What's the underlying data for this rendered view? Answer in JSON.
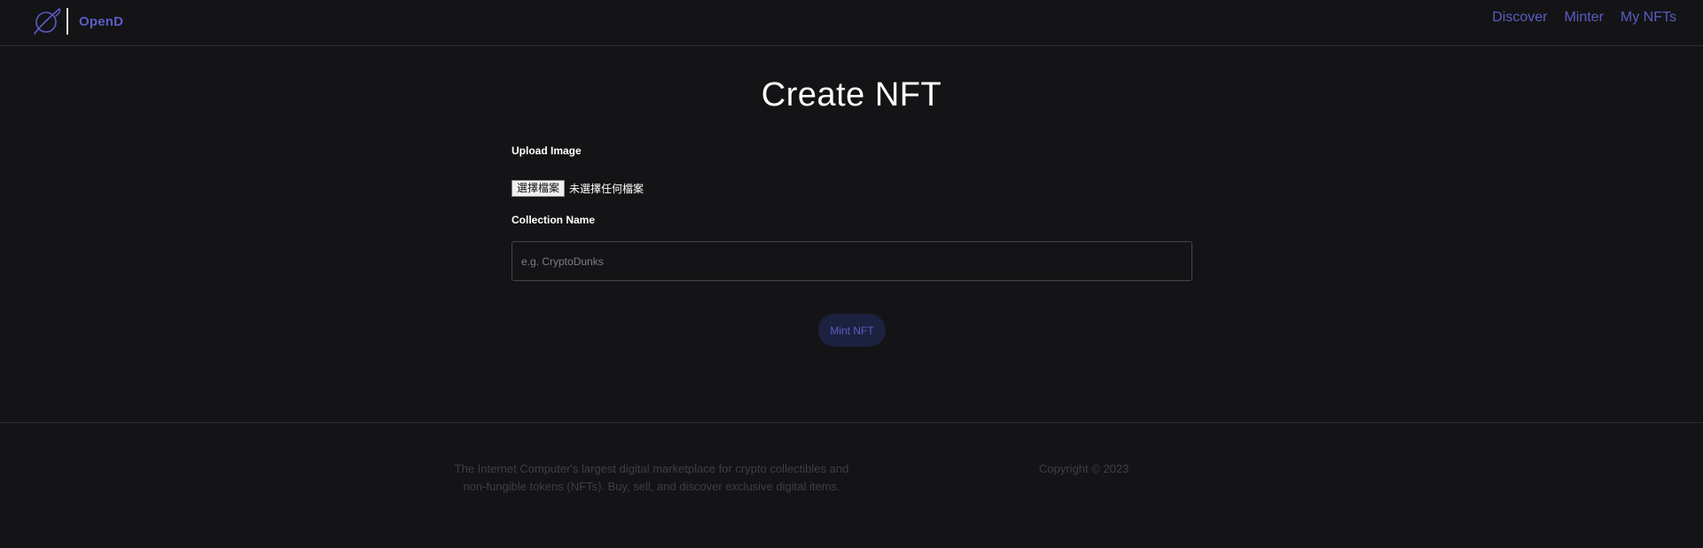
{
  "header": {
    "logo_icon": "planet-ring-icon",
    "brand": "OpenD",
    "nav": [
      {
        "label": "Discover"
      },
      {
        "label": "Minter"
      },
      {
        "label": "My NFTs"
      }
    ]
  },
  "main": {
    "title": "Create NFT",
    "upload_label": "Upload Image",
    "file_button_label": "選擇檔案",
    "file_status": "未選擇任何檔案",
    "collection_label": "Collection Name",
    "collection_placeholder": "e.g. CryptoDunks",
    "collection_value": "",
    "mint_button_label": "Mint NFT"
  },
  "footer": {
    "description_line1": "The Internet Computer's largest digital marketplace for crypto collectibles and",
    "description_line2": "non-fungible tokens (NFTs). Buy, sell, and discover exclusive digital items.",
    "copyright": "Copyright © 2023"
  },
  "colors": {
    "background": "#141416",
    "accent": "#5a5cc4",
    "mint_button_bg": "#1d2140",
    "footer_text": "#3e3e46"
  }
}
